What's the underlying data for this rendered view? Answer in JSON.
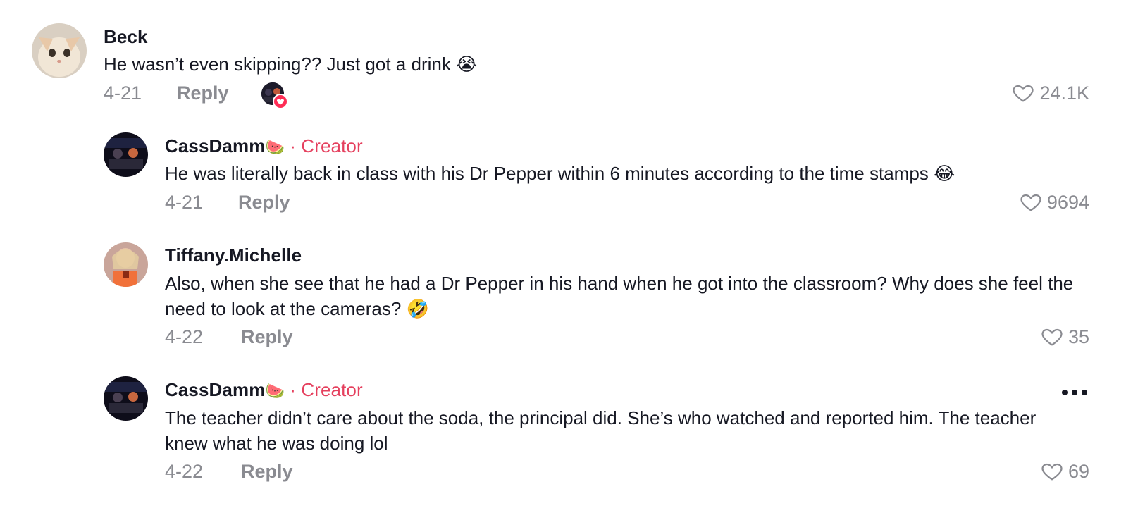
{
  "comments": [
    {
      "username": "Beck",
      "text": "He wasn’t even skipping?? Just got a drink 😭",
      "date": "4-21",
      "reply_label": "Reply",
      "likes": "24.1K",
      "liked_by_creator": true
    },
    {
      "username": "CassDamm",
      "username_emoji": "🍉",
      "creator_tag": " · Creator",
      "text": "He was literally back in class with his Dr Pepper within 6 minutes according to the time stamps 😂",
      "date": "4-21",
      "reply_label": "Reply",
      "likes": "9694"
    },
    {
      "username": "Tiffany.Michelle",
      "text": "Also, when she see that he had a Dr Pepper in his hand when he got into the classroom? Why does she feel the need to look at the cameras? 🤣",
      "date": "4-22",
      "reply_label": "Reply",
      "likes": "35"
    },
    {
      "username": "CassDamm",
      "username_emoji": "🍉",
      "creator_tag": " · Creator",
      "text": "The teacher didn’t care about the soda, the principal did. She’s who watched and reported him. The teacher knew what he was doing lol",
      "date": "4-22",
      "reply_label": "Reply",
      "likes": "69"
    }
  ],
  "colors": {
    "creator_accent": "#e5405e",
    "secondary_text": "#8a8b91",
    "primary_text": "#161823"
  },
  "icons": [
    "heart-outline-icon",
    "more-dots-icon",
    "liked-by-creator-heart-icon"
  ]
}
